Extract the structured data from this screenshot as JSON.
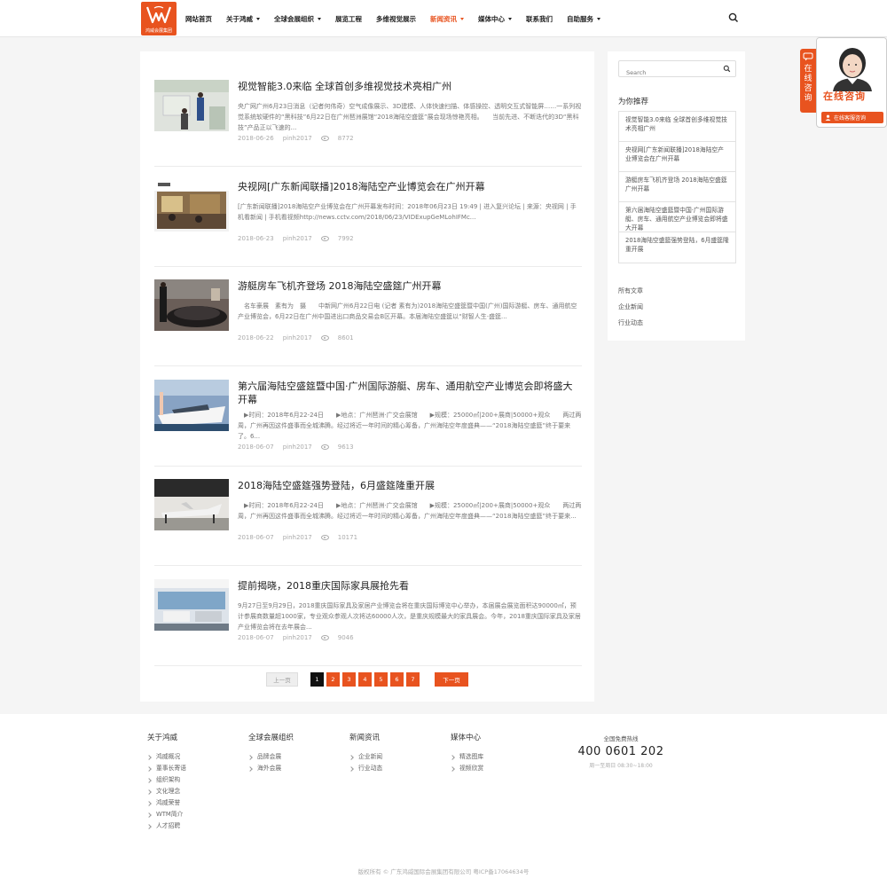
{
  "brand": {
    "logo_text": "鸿威会展集团",
    "accent": "#e8531f"
  },
  "nav": [
    {
      "label": "网站首页",
      "dropdown": false,
      "active": false
    },
    {
      "label": "关于鸿威",
      "dropdown": true,
      "active": false
    },
    {
      "label": "全球会展组织",
      "dropdown": true,
      "active": false
    },
    {
      "label": "展览工程",
      "dropdown": false,
      "active": false
    },
    {
      "label": "多维视觉展示",
      "dropdown": false,
      "active": false
    },
    {
      "label": "新闻资讯",
      "dropdown": true,
      "active": true
    },
    {
      "label": "媒体中心",
      "dropdown": true,
      "active": false
    },
    {
      "label": "联系我们",
      "dropdown": false,
      "active": false
    },
    {
      "label": "自助服务",
      "dropdown": true,
      "active": false
    }
  ],
  "articles": [
    {
      "title": "视觉智能3.0来临 全球首创多维视觉技术亮相广州",
      "excerpt": "央广网广州6月23日消息（记者何伟奇）空气成像展示、3D建模、人体快速扫描、体感操控、透明交互式智能屏……一系列视觉系统软硬件的“黑科技”6月22日在广州琶洲展馆“2018海陆空盛筵”展会现场惊艳亮相。　　当前先进、不断迭代的3D“黑科技”产品正以飞速的...",
      "date": "2018-06-26",
      "author": "pinh2017",
      "views": "8772"
    },
    {
      "title": "央视网[广东新闻联播]2018海陆空产业博览会在广州开幕",
      "excerpt": "[广东新闻联播]2018海陆空产业博览会在广州开幕发布时间：2018年06月23日 19:49 | 进入复兴论坛 | 来源：央视网 | 手机看新闻 | 手机看视频http://news.cctv.com/2018/06/23/VIDExupGeMLohIFMc...",
      "date": "2018-06-23",
      "author": "pinh2017",
      "views": "7992"
    },
    {
      "title": "游艇房车飞机齐登场 2018海陆空盛筵广州开幕",
      "excerpt": "　名车豪展　素有为　摄　　中新网广州6月22日电 (记者 素有为)2018海陆空盛筵暨中国(广州)国际游艇、房车、通用航空产业博览会，6月22日在广州中国进出口商品交易会B区开幕。本届海陆空盛筵以“财智人生·盛筵...",
      "date": "2018-06-22",
      "author": "pinh2017",
      "views": "8601"
    },
    {
      "title": "第六届海陆空盛筵暨中国·广州国际游艇、房车、通用航空产业博览会即将盛大开幕",
      "excerpt": "　▶时间：2018年6月22-24日　　▶地点：广州琶洲·广交会展馆　　▶规模：25000㎡|200+展商|50000+观众　　两过两周，广州再因这件盛事而全城沸腾。经过将近一年时间的精心筹备，广州海陆空年度盛典——“2018海陆空盛筵”终于要来了。6...",
      "date": "2018-06-07",
      "author": "pinh2017",
      "views": "9613"
    },
    {
      "title": "2018海陆空盛筵强势登陆，6月盛筵隆重开展",
      "excerpt": "　▶时间：2018年6月22-24日　　▶地点：广州琶洲·广交会展馆　　▶规模：25000㎡|200+展商|50000+观众　　两过两周，广州再因这件盛事而全城沸腾。经过将近一年时间的精心筹备，广州海陆空年度盛典——“2018海陆空盛筵”终于要来...",
      "date": "2018-06-07",
      "author": "pinh2017",
      "views": "10171"
    },
    {
      "title": "提前揭晓，2018重庆国际家具展抢先看",
      "excerpt": "9月27日至9月29日，2018重庆国际家具及家居产业博览会将在重庆国际博览中心举办，本届展会展览面积达90000㎡，预计参展商数量超1000家，专业观众参观人次将达60000人次，是重庆规模最大的家具展会。今年，2018重庆国际家具及家居产业博览会将在去年展会...",
      "date": "2018-06-07",
      "author": "pinh2017",
      "views": "9046"
    }
  ],
  "pagination": {
    "prev": "上一页",
    "pages": [
      "1",
      "2",
      "3",
      "4",
      "5",
      "6",
      "7"
    ],
    "current": "1",
    "next": "下一页"
  },
  "sidebar": {
    "search_placeholder": "Search",
    "recommend_heading": "为你推荐",
    "recommend": [
      "视觉智能3.0来临 全球首创多维视觉技术亮相广州",
      "央视网[广东新闻联播]2018海陆空产业博览会在广州开幕",
      "游艇房车飞机齐登场 2018海陆空盛筵广州开幕",
      "第六届海陆空盛筵暨中国·广州国际游艇、房车、通用航空产业博览会即将盛大开幕",
      "2018海陆空盛筵强势登陆，6月盛筵隆重开展"
    ],
    "categories": [
      "所有文章",
      "企业新闻",
      "行业动态"
    ]
  },
  "consult": {
    "tab": "在线咨询",
    "label": "在线咨询",
    "button": "在线客服咨询"
  },
  "footer": {
    "columns": [
      {
        "title": "关于鸿威",
        "links": [
          "鸿威概况",
          "董事长寄语",
          "组织架构",
          "文化理念",
          "鸿威荣誉",
          "WTM简介",
          "人才招聘"
        ]
      },
      {
        "title": "全球会展组织",
        "links": [
          "品牌会展",
          "海外会展"
        ]
      },
      {
        "title": "新闻资讯",
        "links": [
          "企业新闻",
          "行业动态"
        ]
      },
      {
        "title": "媒体中心",
        "links": [
          "精选图库",
          "视频欣赏"
        ]
      }
    ],
    "hotline_label": "全国免费热线",
    "hotline": "400 0601 202",
    "hotline_time": "周一至周日 08:30~18:00",
    "copyright": "版权所有 © 广东鸿威国际会展集团有限公司 粤ICP备17064634号"
  }
}
